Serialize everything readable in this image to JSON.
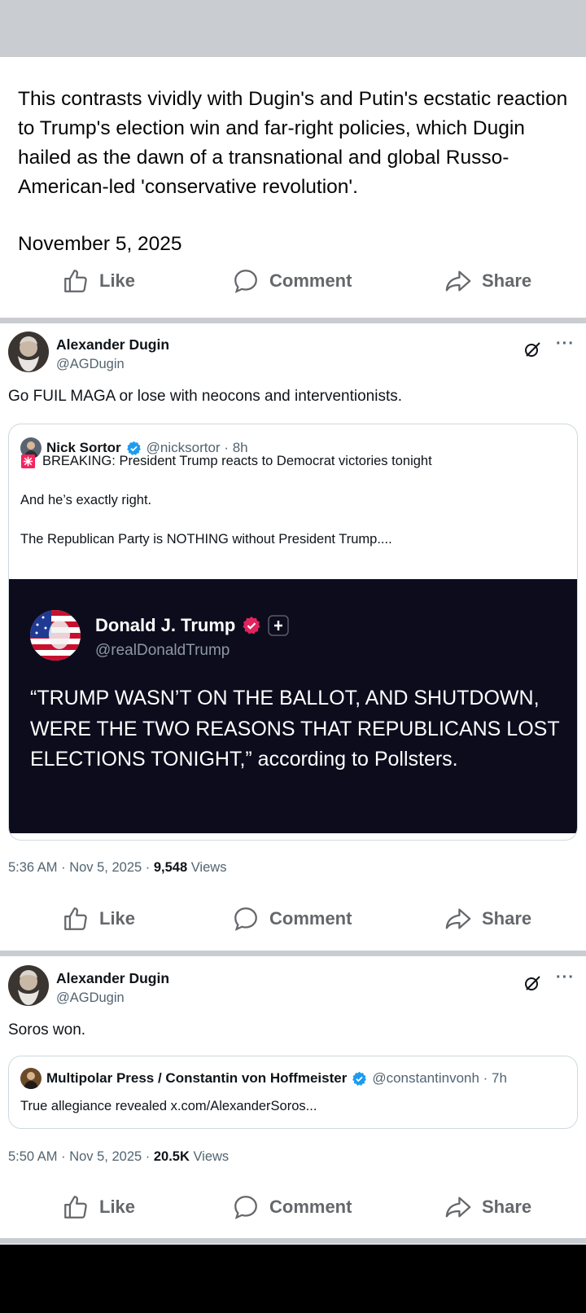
{
  "post": {
    "text": "This contrasts vividly with Dugin's and Putin's ecstatic reaction to Trump's election win and far-right policies, which Dugin hailed as the dawn of a transnational and global Russo-American-led 'conservative revolution'.",
    "date": "November 5, 2025"
  },
  "actions": {
    "like": "Like",
    "comment": "Comment",
    "share": "Share"
  },
  "tweet1": {
    "author": "Alexander Dugin",
    "handle": "@AGDugin",
    "text": "Go FUIL MAGA or lose with neocons and interventionists.",
    "quote": {
      "name": "Nick Sortor",
      "handle_time": "@nicksortor · 8h",
      "line1": "BREAKING: President Trump reacts to Democrat victories tonight",
      "line2": "And he’s exactly right.",
      "line3": "The Republican Party is NOTHING without President Trump....",
      "media": {
        "name": "Donald J. Trump",
        "handle": "@realDonaldTrump",
        "quote": "“TRUMP WASN’T ON THE BALLOT, AND SHUTDOWN, WERE THE TWO REASONS THAT REPUBLICANS LOST ELECTIONS TONIGHT,” according to Pollsters."
      }
    },
    "meta_time": "5:36 AM · Nov 5, 2025 · ",
    "views_count": "9,548",
    "views_label": " Views"
  },
  "tweet2": {
    "author": "Alexander Dugin",
    "handle": "@AGDugin",
    "text": "Soros won.",
    "quote": {
      "name": "Multipolar Press / Constantin von Hoffmeister",
      "handle_time": "@constantinvonh · 7h",
      "line1": "True allegiance revealed x.com/AlexanderSoros..."
    },
    "meta_time": "5:50 AM · Nov 5, 2025 · ",
    "views_count": "20.5K",
    "views_label": " Views"
  },
  "colors": {
    "verified_blue": "#1d9bf0",
    "verified_pink": "#e0245e",
    "media_bg": "#0d0c1d"
  }
}
